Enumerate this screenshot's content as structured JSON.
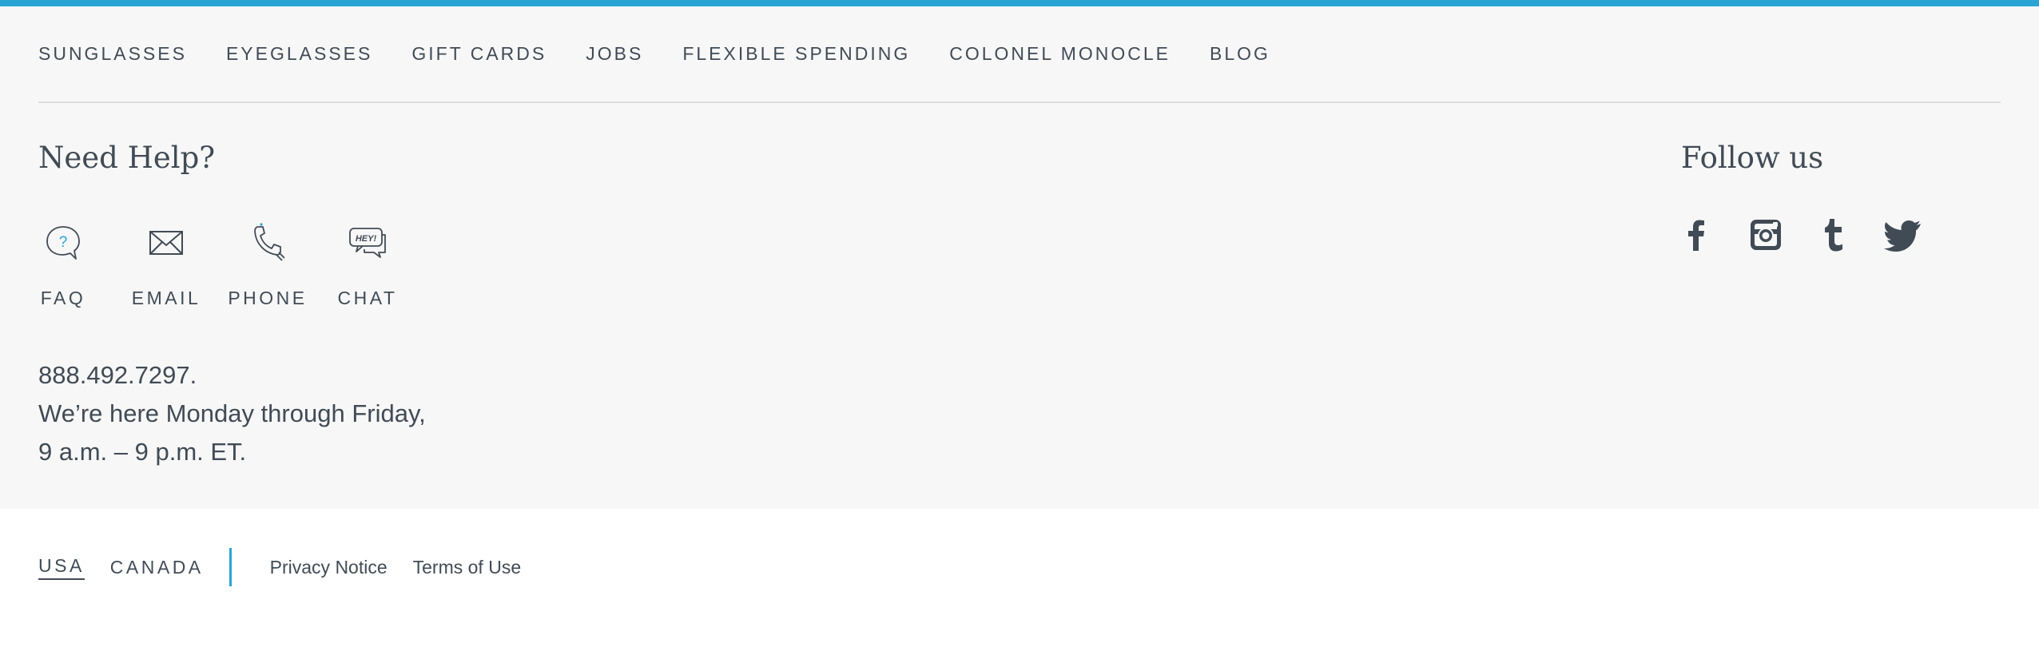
{
  "colors": {
    "accent": "#2aa4d5",
    "text": "#414b56",
    "panel": "#f7f7f7"
  },
  "nav": {
    "items": [
      {
        "label": "SUNGLASSES"
      },
      {
        "label": "EYEGLASSES"
      },
      {
        "label": "GIFT CARDS"
      },
      {
        "label": "JOBS"
      },
      {
        "label": "FLEXIBLE SPENDING"
      },
      {
        "label": "COLONEL MONOCLE"
      },
      {
        "label": "BLOG"
      }
    ]
  },
  "help": {
    "heading": "Need Help?",
    "options": [
      {
        "label": "FAQ",
        "icon": "faq-bubble-icon"
      },
      {
        "label": "EMAIL",
        "icon": "envelope-icon"
      },
      {
        "label": "PHONE",
        "icon": "phone-icon"
      },
      {
        "label": "CHAT",
        "icon": "chat-hey-icon"
      }
    ],
    "chat_bubble_text": "HEY!",
    "faq_icon_glyph": "?",
    "phone": "888.492.7297.",
    "hours_line1": "We’re here Monday through Friday,",
    "hours_line2": "9 a.m. – 9 p.m. ET."
  },
  "follow": {
    "heading": "Follow us",
    "icons": [
      "facebook-icon",
      "instagram-icon",
      "tumblr-icon",
      "twitter-icon"
    ]
  },
  "bottom": {
    "countries": [
      {
        "label": "USA",
        "active": true
      },
      {
        "label": "CANADA",
        "active": false
      }
    ],
    "links": [
      {
        "label": "Privacy Notice"
      },
      {
        "label": "Terms of Use"
      }
    ]
  }
}
